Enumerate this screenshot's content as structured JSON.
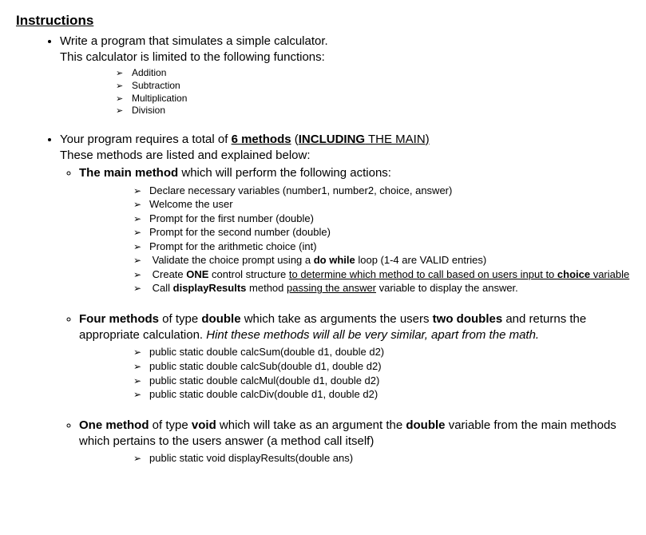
{
  "heading": "Instructions",
  "bullet1": {
    "line1": "Write a program that simulates a simple calculator.",
    "line2": "This calculator is limited to the following functions:",
    "funcs": [
      "Addition",
      "Subtraction",
      "Multiplication",
      "Division"
    ]
  },
  "bullet2": {
    "prefix": "Your program requires a total of ",
    "six_methods": "6 methods",
    "open_paren": " (",
    "including": "INCLUDING",
    "the_main": " THE MAIN)",
    "line2": "These methods are listed and explained below:",
    "sub1": {
      "main_method": "The main method",
      "rest": " which will perform the following actions:",
      "items": {
        "i1": "Declare necessary variables (number1, number2, choice, answer)",
        "i2": "Welcome the user",
        "i3": "Prompt for the first number (double)",
        "i4": "Prompt for the second number (double)",
        "i5": "Prompt for the arithmetic choice (int)",
        "i6_pre": "Validate the choice prompt using a ",
        "i6_bold": "do while",
        "i6_post": " loop (1-4 are VALID entries)",
        "i7_pre": "Create ",
        "i7_one": "ONE",
        "i7_mid": " control structure ",
        "i7_u1": "to determine which method to call based on users input to ",
        "i7_choice": "choice",
        "i7_u2": " variable",
        "i8_pre": "Call ",
        "i8_bold": "displayResults",
        "i8_mid": " method ",
        "i8_u": "passing the answer",
        "i8_post": " variable to display the answer."
      }
    },
    "sub2": {
      "four_methods": "Four methods",
      "mid1": " of type ",
      "double": "double",
      "mid2": " which take as arguments the users ",
      "two_doubles": "two doubles",
      "line2_pre": " and returns the appropriate calculation. ",
      "hint": "Hint these methods will all be very similar, apart from the math.",
      "sigs": [
        "public static double calcSum(double d1, double d2)",
        "public static double calcSub(double d1, double d2)",
        "public static double calcMul(double d1, double d2)",
        "public static double calcDiv(double d1, double d2)"
      ]
    },
    "sub3": {
      "one_method": "One method",
      "mid1": " of type ",
      "void": "void",
      "mid2": " which will take as an argument the ",
      "double": "double",
      "mid3": " variable from the main methods which pertains to the users answer (a method call itself)",
      "sig": "public static void displayResults(double ans)"
    }
  }
}
